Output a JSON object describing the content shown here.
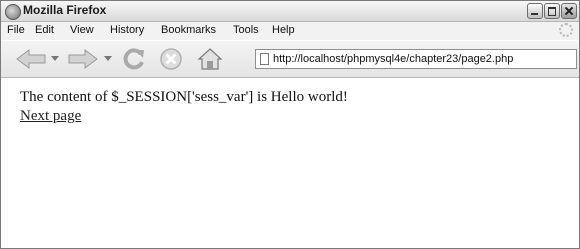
{
  "window": {
    "title": "Mozilla Firefox"
  },
  "menu": {
    "items": [
      {
        "label": "File"
      },
      {
        "label": "Edit"
      },
      {
        "label": "View"
      },
      {
        "label": "History"
      },
      {
        "label": "Bookmarks"
      },
      {
        "label": "Tools"
      },
      {
        "label": "Help"
      }
    ]
  },
  "toolbar": {
    "url": "http://localhost/phpmysql4e/chapter23/page2.php"
  },
  "page": {
    "text": "The content of $_SESSION['sess_var'] is Hello world!",
    "link_label": "Next page"
  }
}
